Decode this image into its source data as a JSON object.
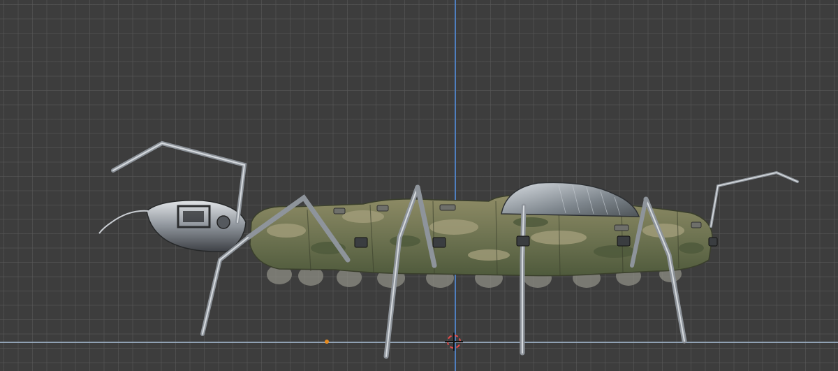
{
  "viewport": {
    "background_color": "#3d3d3d",
    "grid_color": "#5a5a5a",
    "y_axis_color": "#4f7fbf",
    "x_axis_color": "#9fb3c8",
    "cursor_color": "#e34b4b",
    "origin_color": "#e58a1f"
  },
  "model": {
    "camo_colors": [
      "#6f7452",
      "#8c8a63",
      "#4f5a3c",
      "#a29d7a"
    ],
    "metal_colors": [
      "#c9cdd2",
      "#8e949b",
      "#55595e"
    ]
  }
}
